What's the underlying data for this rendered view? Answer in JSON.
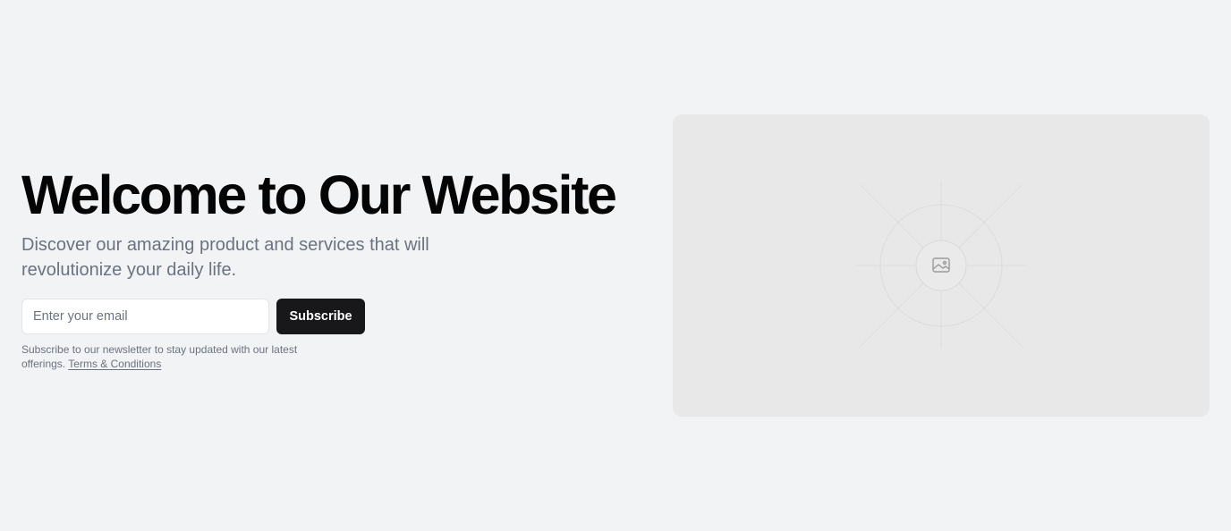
{
  "hero": {
    "title": "Welcome to Our Website",
    "subtitle": "Discover our amazing product and services that will revolutionize your daily life.",
    "form": {
      "email_placeholder": "Enter your email",
      "email_value": "",
      "subscribe_label": "Subscribe"
    },
    "note": {
      "text": "Subscribe to our newsletter to stay updated with our latest offerings.",
      "link_label": "Terms & Conditions"
    }
  },
  "media": {
    "icon": "image-placeholder-icon"
  },
  "colors": {
    "background": "#f2f3f5",
    "heading": "#050505",
    "muted_text": "#6b7280",
    "button_bg": "#18181b",
    "button_text": "#ffffff",
    "placeholder_panel": "#e8e8e9"
  }
}
